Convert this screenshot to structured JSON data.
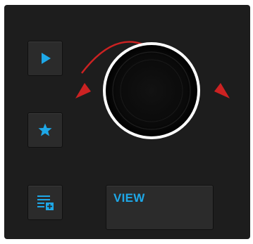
{
  "colors": {
    "accent": "#1ea8e8",
    "arrow": "#cc2222",
    "panel": "#1d1d1d",
    "ring": "#ffffff"
  },
  "buttons": {
    "play": {
      "icon": "play-icon"
    },
    "favorite": {
      "icon": "star-icon"
    },
    "add_to_list": {
      "icon": "list-add-icon"
    },
    "view": {
      "label": "VIEW"
    }
  },
  "encoder": {
    "icon": "rotary-encoder",
    "rotation_indicator": "bidirectional-arc-arrow-icon"
  }
}
